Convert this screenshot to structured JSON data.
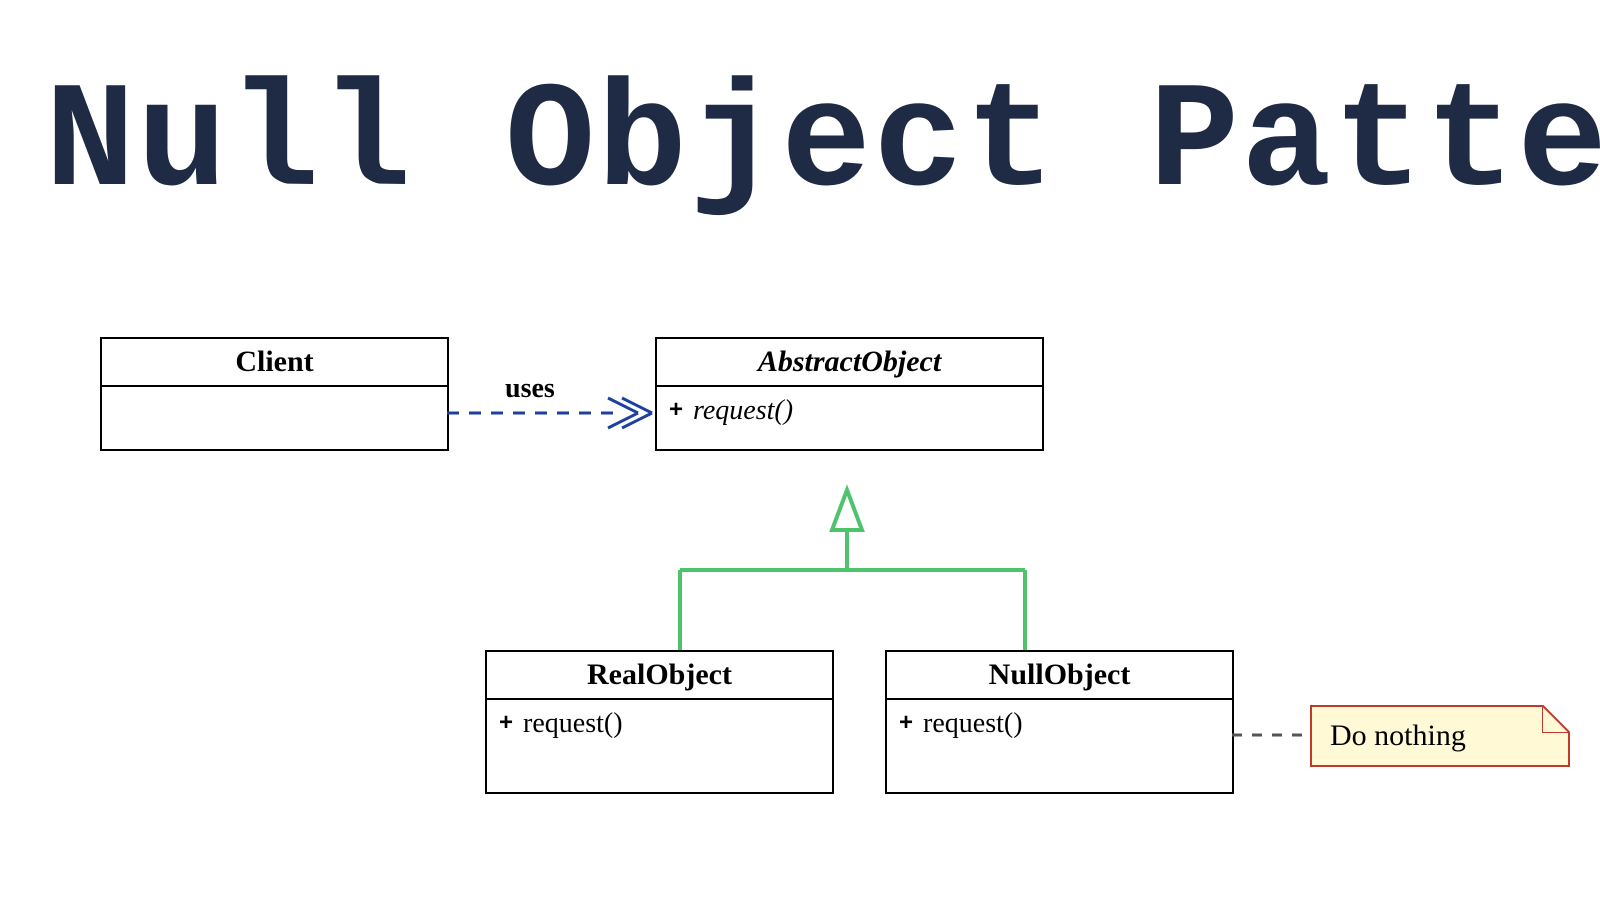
{
  "title": "Null Object Pattern",
  "boxes": {
    "client": {
      "name": "Client",
      "body": ""
    },
    "abstract": {
      "name": "AbstractObject",
      "method": "request()",
      "vis": "+"
    },
    "real": {
      "name": "RealObject",
      "method": "request()",
      "vis": "+"
    },
    "nullobj": {
      "name": "NullObject",
      "method": "request()",
      "vis": "+"
    }
  },
  "relations": {
    "uses": "uses"
  },
  "note": {
    "text": "Do nothing"
  },
  "colors": {
    "title": "#1f2a44",
    "uses_line": "#1c3fa0",
    "inherit_line": "#4fc36b",
    "note_border": "#c0392b",
    "note_fill": "#fff9d6"
  }
}
